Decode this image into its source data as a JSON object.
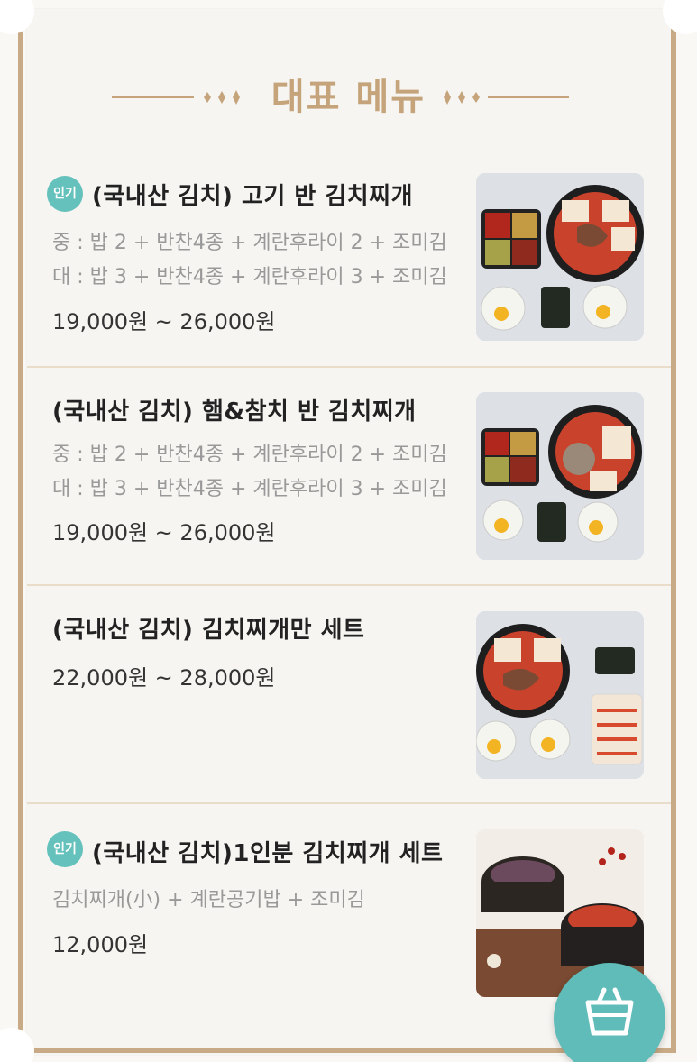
{
  "section": {
    "title": "대표 메뉴"
  },
  "menu_items": [
    {
      "badge": "인기",
      "name": "(국내산 김치) 고기 반 김치찌개",
      "desc1": "중 : 밥 2 + 반찬4종 + 계란후라이 2 + 조미김",
      "desc2": "대 : 밥 3 + 반찬4종 + 계란후라이 3 + 조미김",
      "price": "19,000원 ~ 26,000원"
    },
    {
      "name": "(국내산 김치) 햄&참치 반 김치찌개",
      "desc1": "중 : 밥 2 + 반찬4종 + 계란후라이 2 + 조미김",
      "desc2": "대 : 밥 3 + 반찬4종 + 계란후라이 3 + 조미김",
      "price": "19,000원 ~ 26,000원"
    },
    {
      "name": "(국내산 김치) 김치찌개만 세트",
      "price": "22,000원 ~ 28,000원"
    },
    {
      "badge": "인기",
      "name": "(국내산 김치)1인분 김치찌개 세트",
      "desc1": "김치찌개(小) + 계란공기밥 + 조미김",
      "price": "12,000원"
    }
  ],
  "cart": {
    "icon": "basket-icon"
  },
  "colors": {
    "accent_gold": "#c5a47b",
    "badge_teal": "#65c1bc",
    "fab_teal": "#5fbcb8"
  }
}
